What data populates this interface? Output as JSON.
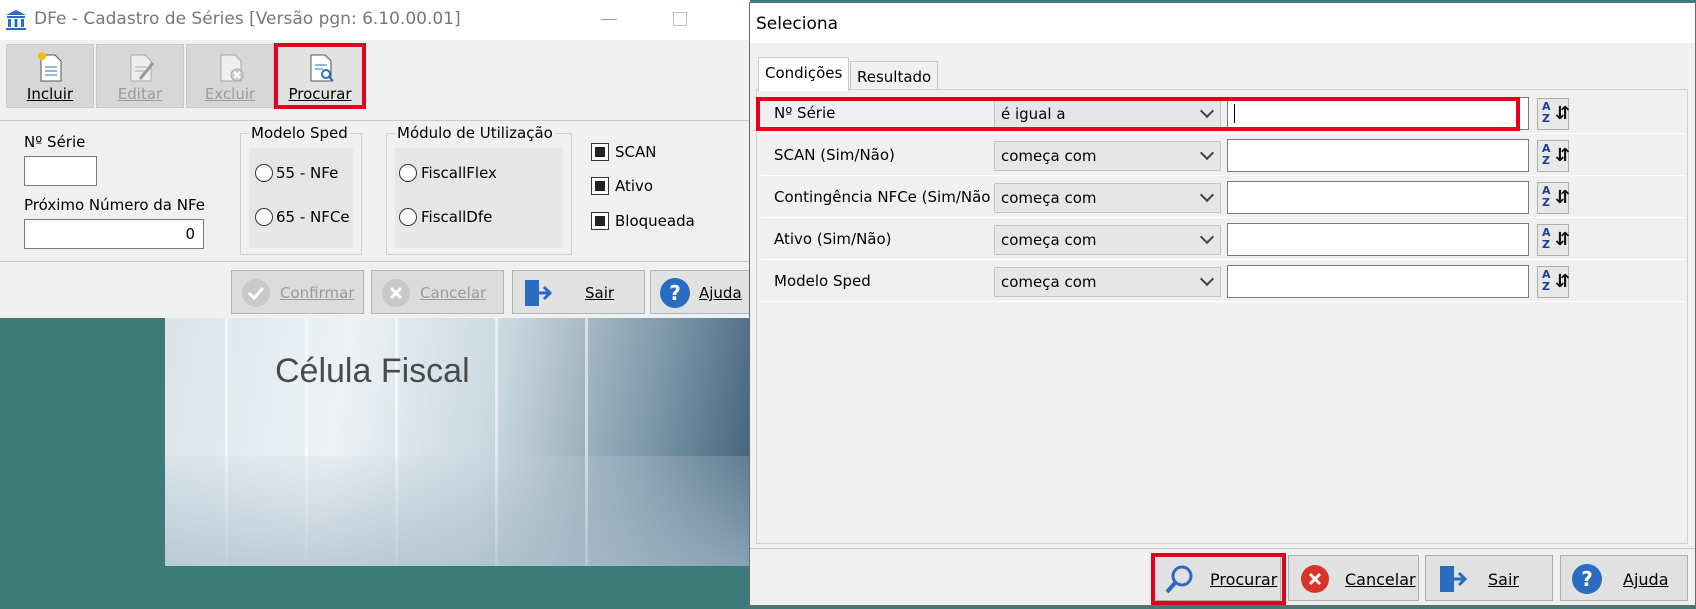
{
  "background": {
    "title": "Célula Fiscal"
  },
  "main_window": {
    "title": "DFe - Cadastro de Séries [Versão pgn: 6.10.00.01]",
    "toolbar": [
      {
        "label": "Incluir",
        "enabled": true
      },
      {
        "label": "Editar",
        "enabled": false
      },
      {
        "label": "Excluir",
        "enabled": false
      },
      {
        "label": "Procurar",
        "enabled": true
      }
    ],
    "form": {
      "serie_label": "Nº Série",
      "serie_value": "",
      "proximo_label": "Próximo Número da NFe",
      "proximo_value": "0",
      "modelo_sped": {
        "title": "Modelo Sped",
        "options": [
          "55 - NFe",
          "65 - NFCe"
        ]
      },
      "modulo": {
        "title": "Módulo de Utilização",
        "options": [
          "FiscallFlex",
          "FiscallDfe"
        ]
      },
      "checkboxes": [
        {
          "label": "SCAN",
          "checked": true
        },
        {
          "label": "Ativo",
          "checked": true
        },
        {
          "label": "Bloqueada",
          "checked": true
        }
      ]
    },
    "actions": [
      {
        "label": "Confirmar",
        "enabled": false
      },
      {
        "label": "Cancelar",
        "enabled": false
      },
      {
        "label": "Sair",
        "enabled": true
      },
      {
        "label": "Ajuda",
        "enabled": true
      }
    ]
  },
  "dialog": {
    "title": "Seleciona",
    "tabs": [
      "Condições",
      "Resultado"
    ],
    "active_tab": "Condições",
    "criteria": [
      {
        "field": "Nº Série",
        "operator": "é igual a",
        "value": ""
      },
      {
        "field": "SCAN (Sim/Não)",
        "operator": "começa com",
        "value": ""
      },
      {
        "field": "Contingência NFCe (Sim/Não)",
        "operator": "começa com",
        "value": ""
      },
      {
        "field": "Ativo (Sim/Não)",
        "operator": "começa com",
        "value": ""
      },
      {
        "field": "Modelo Sped",
        "operator": "começa com",
        "value": ""
      }
    ],
    "sort_label_a": "A",
    "sort_label_z": "Z",
    "buttons": [
      {
        "label": "Procurar"
      },
      {
        "label": "Cancelar"
      },
      {
        "label": "Sair"
      },
      {
        "label": "Ajuda"
      }
    ]
  },
  "colors": {
    "highlight": "#e2001a",
    "desktop": "#3d7b7b",
    "icon_blue": "#2a6cc2",
    "cancel_red": "#d9342b"
  }
}
